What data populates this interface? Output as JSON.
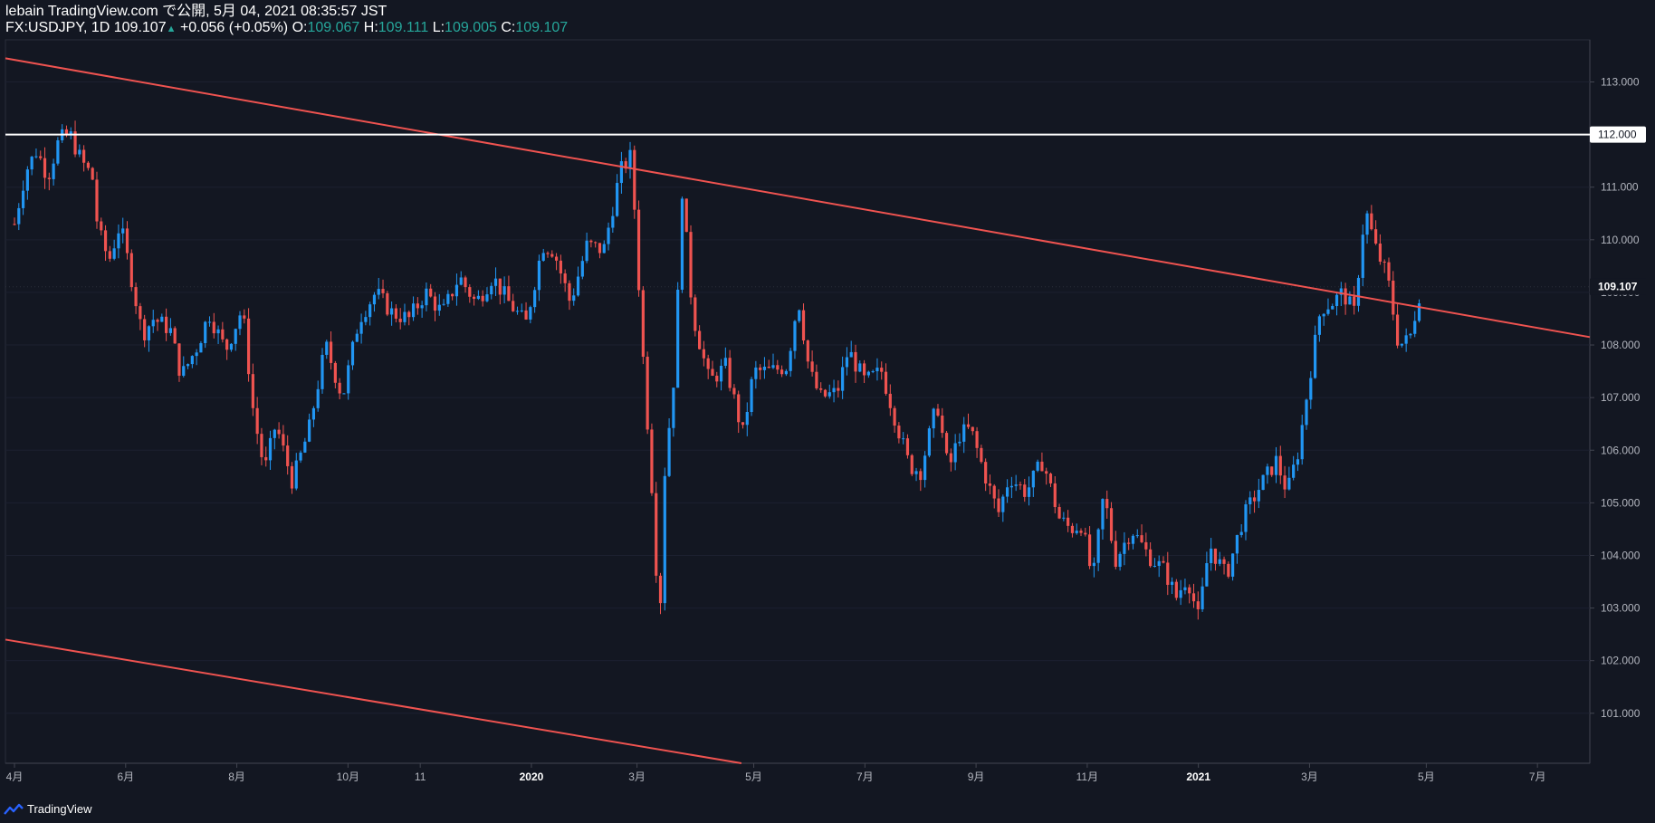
{
  "header": {
    "publisher": "lebain TradingView.com で公開, 5月 04, 2021 08:35:57 JST",
    "symbol": "FX:USDJPY, 1D",
    "last": "109.107",
    "change": "+0.056 (+0.05%)",
    "o_label": "O:",
    "o_value": "109.067",
    "h_label": "H:",
    "h_value": "109.111",
    "l_label": "L:",
    "l_value": "109.005",
    "c_label": "C:",
    "c_value": "109.107"
  },
  "brand": "TradingView",
  "colors": {
    "bg": "#131722",
    "up": "#2196f3",
    "down": "#ef5350",
    "line": "#ef5350",
    "hline": "#ffffff",
    "axis": "#b2b5be"
  },
  "chart_data": {
    "type": "candlestick",
    "title": "",
    "ylim": [
      100.05,
      113.8
    ],
    "xlim": [
      0,
      28
    ],
    "y_ticks": [
      101,
      102,
      103,
      104,
      105,
      106,
      107,
      108,
      109,
      110,
      111,
      112,
      113
    ],
    "x_ticks": [
      {
        "x": 0,
        "label": "4月"
      },
      {
        "x": 2,
        "label": "6月"
      },
      {
        "x": 4,
        "label": "8月"
      },
      {
        "x": 6,
        "label": "10月"
      },
      {
        "x": 7.3,
        "label": "11"
      },
      {
        "x": 9.3,
        "label": "2020"
      },
      {
        "x": 11.2,
        "label": "3月"
      },
      {
        "x": 13.3,
        "label": "5月"
      },
      {
        "x": 15.3,
        "label": "7月"
      },
      {
        "x": 17.3,
        "label": "9月"
      },
      {
        "x": 19.3,
        "label": "11月"
      },
      {
        "x": 21.3,
        "label": "2021"
      },
      {
        "x": 23.3,
        "label": "3月"
      },
      {
        "x": 25.4,
        "label": "5月"
      },
      {
        "x": 27.4,
        "label": "7月"
      }
    ],
    "price_path": [
      [
        0,
        110.3
      ],
      [
        0.2,
        111.3
      ],
      [
        0.4,
        111.7
      ],
      [
        0.6,
        111.2
      ],
      [
        0.8,
        111.9
      ],
      [
        1.0,
        112.0
      ],
      [
        1.2,
        111.5
      ],
      [
        1.4,
        111.2
      ],
      [
        1.5,
        110.2
      ],
      [
        1.7,
        109.6
      ],
      [
        1.9,
        110.3
      ],
      [
        2.1,
        109.3
      ],
      [
        2.3,
        108.2
      ],
      [
        2.5,
        108.5
      ],
      [
        2.8,
        108.3
      ],
      [
        3.0,
        107.4
      ],
      [
        3.3,
        108.0
      ],
      [
        3.5,
        108.6
      ],
      [
        3.8,
        107.9
      ],
      [
        4.1,
        108.7
      ],
      [
        4.3,
        106.7
      ],
      [
        4.5,
        105.6
      ],
      [
        4.7,
        106.5
      ],
      [
        5.0,
        105.4
      ],
      [
        5.3,
        106.4
      ],
      [
        5.6,
        108.0
      ],
      [
        5.9,
        107.0
      ],
      [
        6.2,
        108.5
      ],
      [
        6.5,
        109.0
      ],
      [
        6.8,
        108.6
      ],
      [
        7.1,
        108.5
      ],
      [
        7.4,
        109.0
      ],
      [
        7.7,
        108.6
      ],
      [
        8.0,
        109.3
      ],
      [
        8.3,
        108.8
      ],
      [
        8.6,
        109.3
      ],
      [
        8.9,
        108.8
      ],
      [
        9.2,
        108.4
      ],
      [
        9.5,
        109.9
      ],
      [
        9.7,
        109.8
      ],
      [
        10.0,
        108.8
      ],
      [
        10.3,
        109.9
      ],
      [
        10.6,
        109.8
      ],
      [
        10.9,
        111.3
      ],
      [
        11.1,
        111.6
      ],
      [
        11.3,
        107.9
      ],
      [
        11.5,
        104.8
      ],
      [
        11.6,
        102.5
      ],
      [
        11.7,
        105.6
      ],
      [
        11.9,
        107.8
      ],
      [
        12.0,
        111.1
      ],
      [
        12.2,
        108.6
      ],
      [
        12.5,
        107.3
      ],
      [
        12.8,
        107.6
      ],
      [
        13.1,
        106.3
      ],
      [
        13.3,
        107.5
      ],
      [
        13.6,
        107.5
      ],
      [
        13.9,
        107.6
      ],
      [
        14.1,
        108.9
      ],
      [
        14.3,
        107.5
      ],
      [
        14.5,
        107.0
      ],
      [
        14.8,
        107.1
      ],
      [
        15.0,
        107.9
      ],
      [
        15.3,
        107.3
      ],
      [
        15.6,
        107.5
      ],
      [
        15.9,
        106.4
      ],
      [
        16.1,
        105.7
      ],
      [
        16.3,
        105.6
      ],
      [
        16.6,
        106.9
      ],
      [
        16.8,
        105.6
      ],
      [
        17.0,
        106.3
      ],
      [
        17.2,
        106.4
      ],
      [
        17.5,
        105.4
      ],
      [
        17.7,
        104.8
      ],
      [
        17.9,
        105.5
      ],
      [
        18.2,
        105.2
      ],
      [
        18.5,
        105.8
      ],
      [
        18.8,
        104.7
      ],
      [
        19.0,
        104.5
      ],
      [
        19.2,
        104.6
      ],
      [
        19.4,
        103.5
      ],
      [
        19.6,
        105.2
      ],
      [
        19.8,
        103.9
      ],
      [
        20.1,
        104.5
      ],
      [
        20.4,
        104.0
      ],
      [
        20.7,
        103.7
      ],
      [
        20.9,
        103.2
      ],
      [
        21.1,
        103.6
      ],
      [
        21.3,
        102.8
      ],
      [
        21.5,
        104.2
      ],
      [
        21.8,
        103.6
      ],
      [
        22.1,
        104.7
      ],
      [
        22.4,
        105.3
      ],
      [
        22.7,
        105.8
      ],
      [
        22.9,
        105.2
      ],
      [
        23.1,
        106.0
      ],
      [
        23.3,
        107.4
      ],
      [
        23.5,
        108.7
      ],
      [
        23.7,
        108.8
      ],
      [
        23.9,
        109.0
      ],
      [
        24.1,
        108.6
      ],
      [
        24.3,
        110.6
      ],
      [
        24.5,
        109.8
      ],
      [
        24.7,
        109.3
      ],
      [
        24.9,
        108.0
      ],
      [
        25.1,
        108.1
      ],
      [
        25.3,
        109.1
      ]
    ],
    "upper_trendline": {
      "x": [
        0,
        28
      ],
      "y": [
        113.45,
        108.15
      ]
    },
    "lower_trendline": {
      "x": [
        0,
        12.1
      ],
      "y": [
        102.4,
        100.05
      ]
    },
    "horizontal_line": {
      "y": 112.0,
      "label": "112.000"
    },
    "last_price": {
      "y": 109.107,
      "label": "109.107"
    }
  }
}
